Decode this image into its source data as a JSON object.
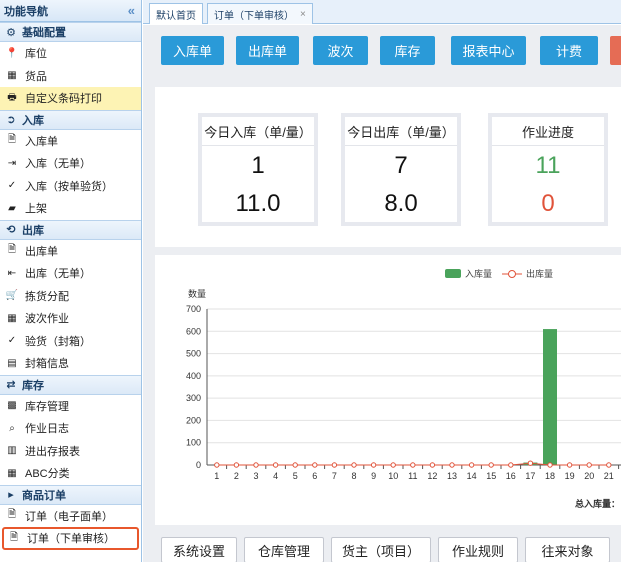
{
  "sidebar": {
    "title": "功能导航",
    "groups": [
      {
        "label": "基础配置",
        "icon": "gear-icon",
        "items": [
          {
            "label": "库位",
            "icon": "map-pin-icon"
          },
          {
            "label": "货品",
            "icon": "grid-icon"
          },
          {
            "label": "自定义条码打印",
            "icon": "printer-icon",
            "highlight": true
          }
        ]
      },
      {
        "label": "入库",
        "icon": "circle-arrow-right-icon",
        "items": [
          {
            "label": "入库单",
            "icon": "document-icon"
          },
          {
            "label": "入库（无单）",
            "icon": "sign-in-icon"
          },
          {
            "label": "入库（按单验货）",
            "icon": "check-icon"
          },
          {
            "label": "上架",
            "icon": "book-icon"
          }
        ]
      },
      {
        "label": "出库",
        "icon": "circle-arrow-left-icon",
        "items": [
          {
            "label": "出库单",
            "icon": "document-icon"
          },
          {
            "label": "出库（无单）",
            "icon": "sign-out-icon"
          },
          {
            "label": "拣货分配",
            "icon": "shopping-cart-icon"
          },
          {
            "label": "波次作业",
            "icon": "grid-icon"
          },
          {
            "label": "验货（封箱）",
            "icon": "check-icon"
          },
          {
            "label": "封箱信息",
            "icon": "list-icon"
          }
        ]
      },
      {
        "label": "库存",
        "icon": "exchange-icon",
        "items": [
          {
            "label": "库存管理",
            "icon": "cubes-icon"
          },
          {
            "label": "作业日志",
            "icon": "search-icon"
          },
          {
            "label": "进出存报表",
            "icon": "bar-chart-icon"
          },
          {
            "label": "ABC分类",
            "icon": "table-icon"
          }
        ]
      },
      {
        "label": "商品订单",
        "icon": "caret-right-icon",
        "items": [
          {
            "label": "订单（电子面单）",
            "icon": "document-icon"
          },
          {
            "label": "订单（下单审核）",
            "icon": "document-icon",
            "selected": true
          }
        ]
      }
    ]
  },
  "tabs": [
    {
      "label": "默认首页",
      "active": true
    },
    {
      "label": "订单（下单审核）",
      "closable": true,
      "close_glyph": "×"
    }
  ],
  "toolbar": {
    "buttons": [
      "入库单",
      "出库单",
      "波次",
      "库存",
      "报表中心",
      "计费"
    ]
  },
  "stats": [
    {
      "title": "今日入库（单/量）",
      "value1": "1",
      "value2": "11.0",
      "color1": "#111111",
      "color2": "#111111"
    },
    {
      "title": "今日出库（单/量）",
      "value1": "7",
      "value2": "8.0",
      "color1": "#111111",
      "color2": "#111111"
    },
    {
      "title": "作业进度",
      "value1": "11",
      "value2": "0",
      "color1": "#4aa35b",
      "color2": "#e0533a"
    }
  ],
  "chart_data": {
    "type": "bar",
    "ylabel": "数量",
    "ylim": [
      0,
      700
    ],
    "yticks": [
      0,
      100,
      200,
      300,
      400,
      500,
      600,
      700
    ],
    "categories": [
      "1",
      "2",
      "3",
      "4",
      "5",
      "6",
      "7",
      "8",
      "9",
      "10",
      "11",
      "12",
      "13",
      "14",
      "15",
      "16",
      "17",
      "18",
      "19",
      "20",
      "21"
    ],
    "series": [
      {
        "name": "入库量",
        "kind": "bar",
        "color": "#4aa35b",
        "values": [
          0,
          0,
          0,
          0,
          0,
          0,
          0,
          0,
          0,
          0,
          0,
          0,
          0,
          0,
          0,
          0,
          11,
          610,
          0,
          0,
          0
        ]
      },
      {
        "name": "出库量",
        "kind": "line",
        "color": "#e0533a",
        "values": [
          0,
          0,
          0,
          0,
          0,
          0,
          0,
          0,
          0,
          0,
          0,
          0,
          0,
          0,
          0,
          0,
          8,
          0,
          0,
          0,
          0
        ]
      }
    ],
    "legend": "top-right",
    "grid": true,
    "footer_label": "总入库量："
  },
  "bottom_buttons": [
    "系统设置",
    "仓库管理",
    "货主（项目）",
    "作业规则",
    "往来对象"
  ],
  "colors": {
    "accent": "#2a9ad8",
    "highlight": "#fdf3b4",
    "selected_border": "#e8572c"
  }
}
